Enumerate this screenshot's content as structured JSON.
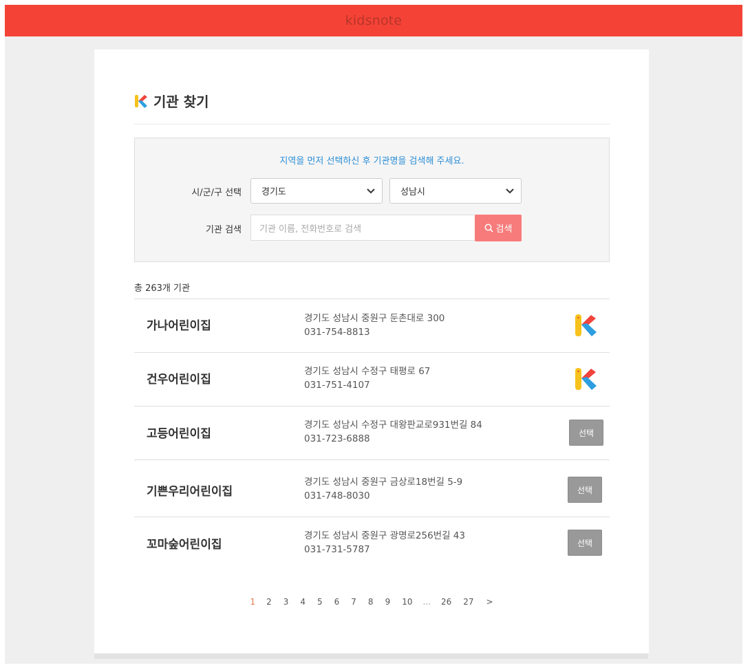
{
  "app": {
    "brand": "kidsnote"
  },
  "colors": {
    "topbar": "#f44336",
    "accent": "#2a8fd6",
    "search_button": "#f77b7b",
    "select_button": "#999999",
    "active_page": "#e07a4c"
  },
  "header": {
    "title": "기관 찾기",
    "logo_icon": "kidsnote-k-icon"
  },
  "search": {
    "notice": "지역을 먼저 선택하신 후 기관명을 검색해 주세요.",
    "region_label": "시/군/구 선택",
    "province_value": "경기도",
    "city_value": "성남시",
    "keyword_label": "기관 검색",
    "keyword_placeholder": "기관 이름, 전화번호로 검색",
    "button_label": "검색"
  },
  "results": {
    "total": "총 263개 기관",
    "items": [
      {
        "name": "가나어린이집",
        "address": "경기도 성남시 중원구 둔촌대로 300",
        "phone": "031-754-8813",
        "action": "kidsnote-icon"
      },
      {
        "name": "건우어린이집",
        "address": "경기도 성남시 수정구 태평로 67",
        "phone": "031-751-4107",
        "action": "kidsnote-icon"
      },
      {
        "name": "고등어린이집",
        "address": "경기도 성남시 수정구 대왕판교로931번길 84",
        "phone": "031-723-6888",
        "action": "선택"
      },
      {
        "name": "기쁜우리어린이집",
        "address": "경기도 성남시 중원구 금상로18번길 5-9",
        "phone": "031-748-8030",
        "action": "선택"
      },
      {
        "name": "꼬마숲어린이집",
        "address": "경기도 성남시 중원구 광명로256번길 43",
        "phone": "031-731-5787",
        "action": "선택"
      }
    ]
  },
  "pagination": {
    "pages": [
      "1",
      "2",
      "3",
      "4",
      "5",
      "6",
      "7",
      "8",
      "9",
      "10",
      "...",
      "26",
      "27",
      ">"
    ],
    "active": "1"
  }
}
